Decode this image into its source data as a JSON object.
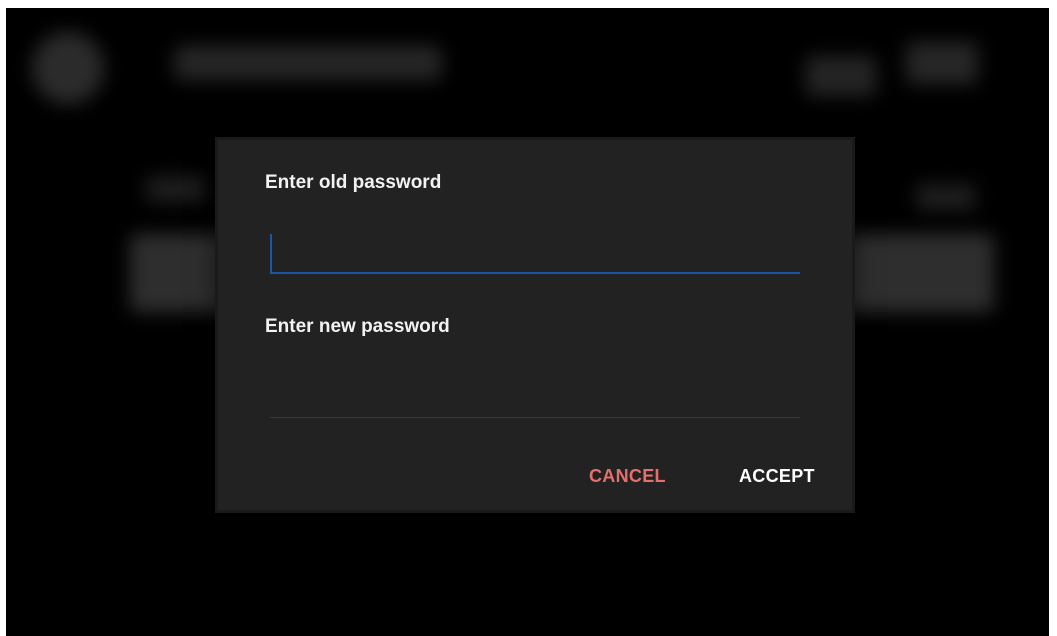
{
  "dialog": {
    "old_password_label": "Enter old password",
    "old_password_value": "",
    "new_password_label": "Enter new password",
    "new_password_value": "",
    "cancel_label": "CANCEL",
    "accept_label": "ACCEPT"
  },
  "colors": {
    "cancel": "#e2706d",
    "focus_underline": "#1a56a8",
    "dialog_background": "#222222"
  }
}
